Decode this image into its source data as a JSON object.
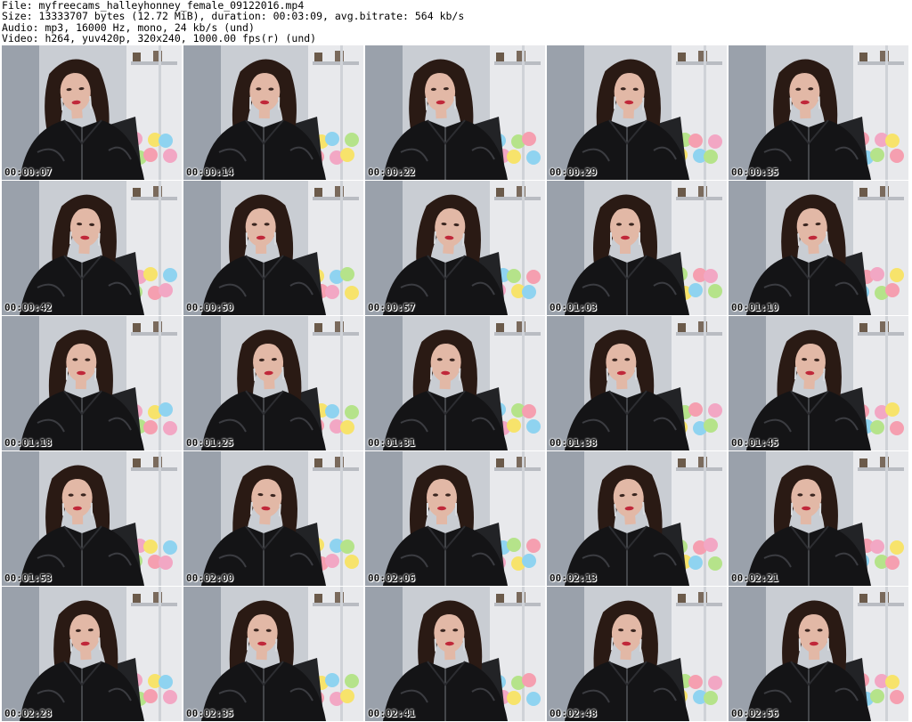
{
  "header": {
    "line1": "File: myfreecams_halleyhonney_female_09122016.mp4",
    "line2": "Size: 13333707 bytes (12.72 MiB), duration: 00:03:09, avg.bitrate: 564 kb/s",
    "line3": "Audio: mp3, 16000 Hz, mono, 24 kb/s (und)",
    "line4": "Video: h264, yuv420p, 320x240, 1000.00 fps(r) (und)"
  },
  "colors": {
    "wall": "#c9cdd3",
    "hair": "#2a1a14",
    "skin": "#e2b8a6",
    "jacket": "#141416",
    "lips": "#c0283a"
  },
  "thumbnails": [
    {
      "timestamp": "00:00:07"
    },
    {
      "timestamp": "00:00:14"
    },
    {
      "timestamp": "00:00:22"
    },
    {
      "timestamp": "00:00:29"
    },
    {
      "timestamp": "00:00:35"
    },
    {
      "timestamp": "00:00:42"
    },
    {
      "timestamp": "00:00:50"
    },
    {
      "timestamp": "00:00:57"
    },
    {
      "timestamp": "00:01:03"
    },
    {
      "timestamp": "00:01:10"
    },
    {
      "timestamp": "00:01:18"
    },
    {
      "timestamp": "00:01:25"
    },
    {
      "timestamp": "00:01:31"
    },
    {
      "timestamp": "00:01:38"
    },
    {
      "timestamp": "00:01:45"
    },
    {
      "timestamp": "00:01:53"
    },
    {
      "timestamp": "00:02:00"
    },
    {
      "timestamp": "00:02:06"
    },
    {
      "timestamp": "00:02:13"
    },
    {
      "timestamp": "00:02:21"
    },
    {
      "timestamp": "00:02:28"
    },
    {
      "timestamp": "00:02:35"
    },
    {
      "timestamp": "00:02:41"
    },
    {
      "timestamp": "00:02:48"
    },
    {
      "timestamp": "00:02:56"
    }
  ]
}
